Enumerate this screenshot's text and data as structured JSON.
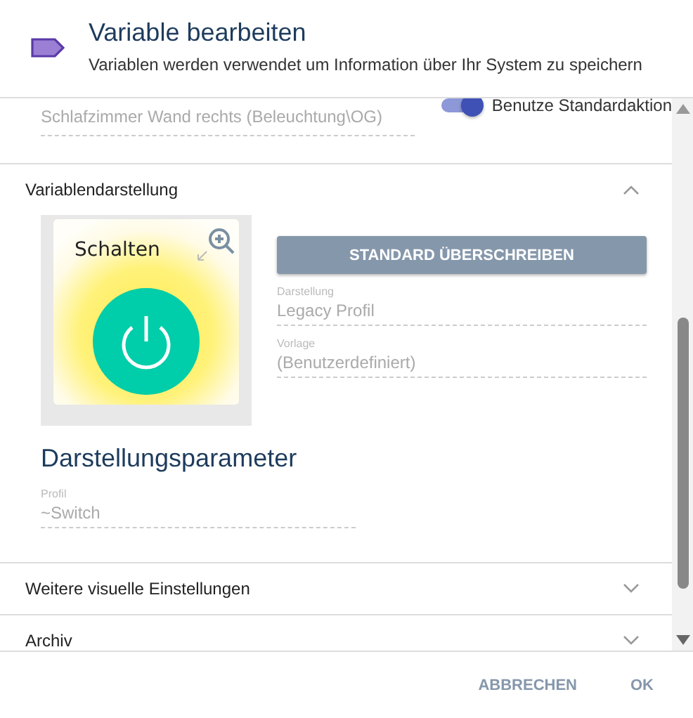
{
  "dialog": {
    "title": "Variable bearbeiten",
    "subtitle": "Variablen werden verwendet um Information über Ihr System zu speichern"
  },
  "top_row": {
    "field_value": "Schlafzimmer Wand rechts (Beleuchtung\\OG)",
    "toggle": {
      "label": "Benutze Standardaktion",
      "on": true
    }
  },
  "sections": [
    {
      "title": "Variablendarstellung",
      "expanded": true
    },
    {
      "title": "Weitere visuelle Einstellungen",
      "expanded": false
    },
    {
      "title": "Archiv",
      "expanded": false
    }
  ],
  "preview": {
    "label": "Schalten",
    "on": true
  },
  "override_button": "STANDARD ÜBERSCHREIBEN",
  "fields": [
    {
      "label": "Darstellung",
      "value": "Legacy Profil"
    },
    {
      "label": "Vorlage",
      "value": "(Benutzerdefiniert)"
    }
  ],
  "parameters": {
    "heading": "Darstellungsparameter",
    "fields": [
      {
        "label": "Profil",
        "value": "~Switch"
      }
    ]
  },
  "buttons": [
    "ABBRECHEN",
    "OK"
  ]
}
